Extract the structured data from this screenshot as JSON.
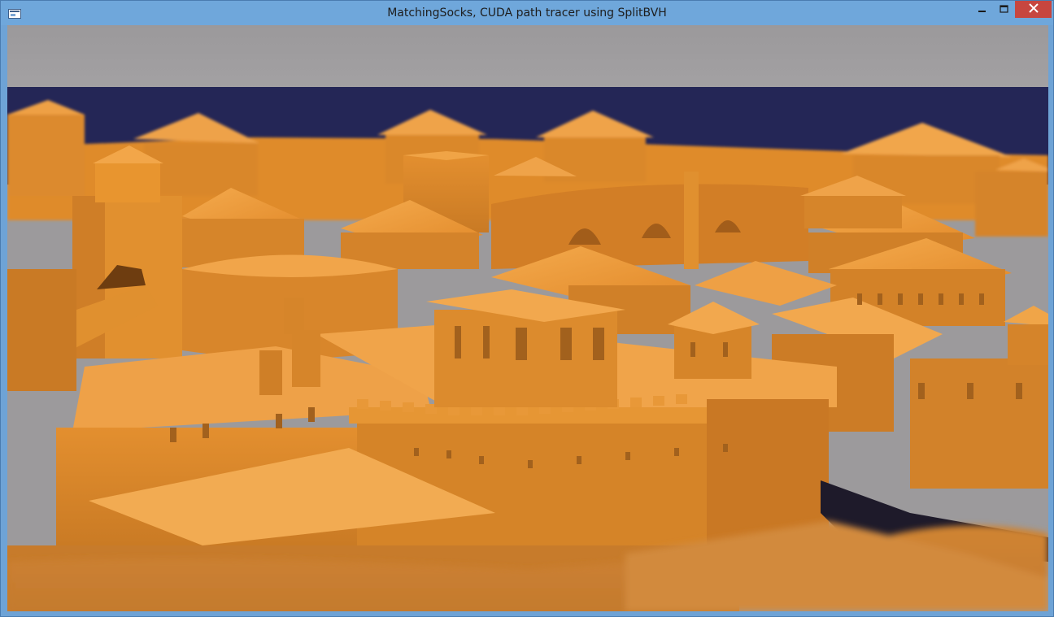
{
  "window": {
    "title": "MatchingSocks, CUDA path tracer using SplitBVH",
    "icons": {
      "app": "app-window-icon",
      "minimize": "minimize-icon",
      "maximize": "maximize-icon",
      "close": "close-icon"
    }
  },
  "viewport": {
    "content": "rendered-scene",
    "colors": {
      "sky": "#9c9a9c",
      "sea": "#252755",
      "building": "#e6922f",
      "building_light": "#f2a745",
      "building_shadow": "#b86a1e"
    }
  }
}
